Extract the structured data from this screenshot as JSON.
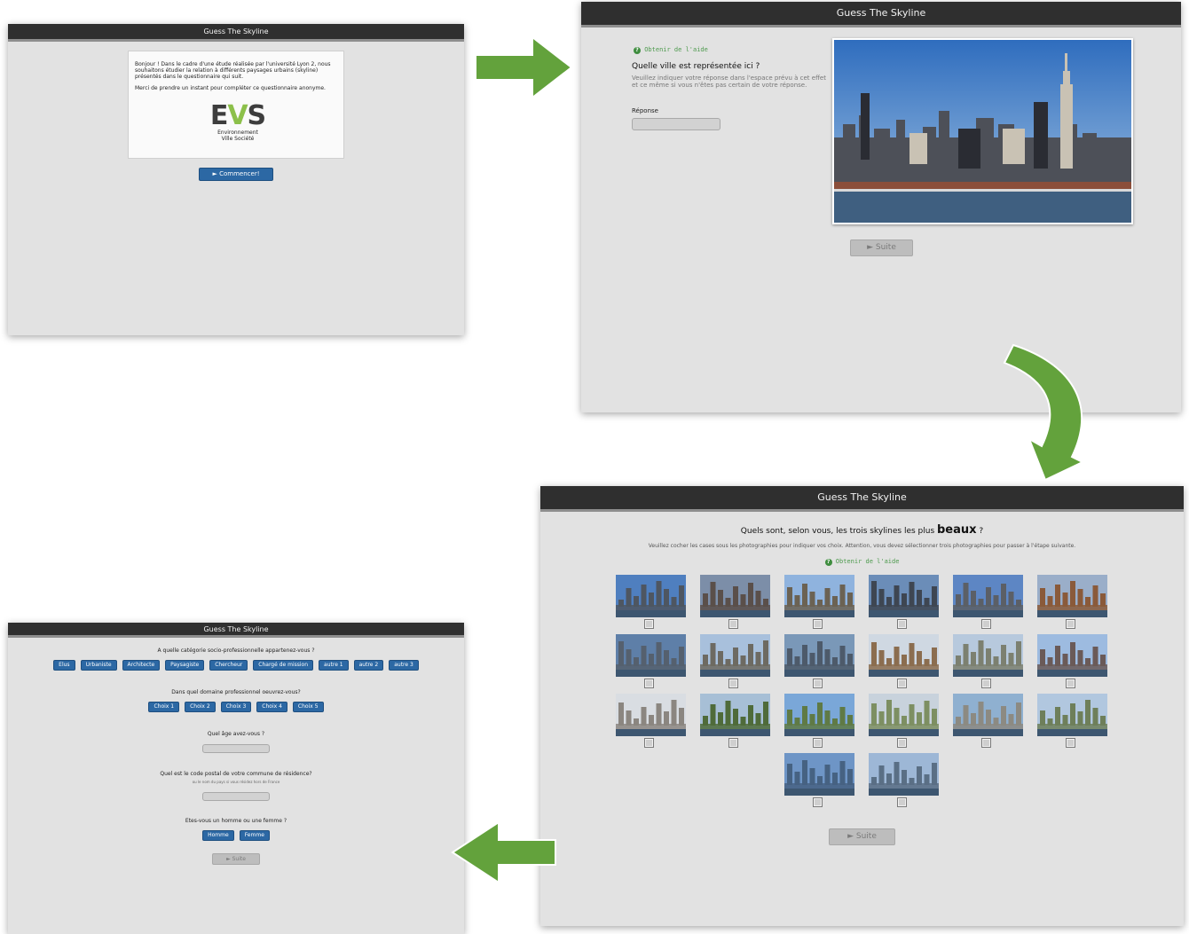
{
  "app_title": "Guess The Skyline",
  "help_label": "Obtenir de l'aide",
  "help_icon": "?",
  "suite_label": "► Suite",
  "intro": {
    "paragraph1": "Bonjour ! Dans le cadre d'une étude réalisée par l'université Lyon 2, nous souhaitons étudier la relation à différents paysages urbains (skyline) présentés dans le questionnaire qui suit.",
    "paragraph2": "Merci de prendre un instant pour compléter ce questionnaire anonyme.",
    "logo_letters": {
      "e": "E",
      "v": "V",
      "s": "S"
    },
    "logo_line1": "Environnement",
    "logo_line2": "Ville Société",
    "start_label": "► Commencer!"
  },
  "guess": {
    "question": "Quelle ville est représentée ici ?",
    "instructions": "Veuillez indiquer votre réponse dans l'espace prévu à cet effet et ce même si vous n'êtes pas certain de votre réponse.",
    "answer_label": "Réponse",
    "answer_value": ""
  },
  "ranking": {
    "question_prefix": "Quels sont, selon vous, les trois skylines les plus ",
    "question_emphasis": "beaux",
    "question_suffix": " ?",
    "instructions": "Veuillez cocher les cases sous les photographies pour indiquer vos choix. Attention, vous devez sélectionner trois photographies pour passer à l'étape suivante.",
    "photo_count": 20
  },
  "profile": {
    "q_category": "A quelle catégorie socio-professionnelle appartenez-vous ?",
    "categories": [
      "Elus",
      "Urbaniste",
      "Architecte",
      "Paysagiste",
      "Chercheur",
      "Chargé de mission",
      "autre 1",
      "autre 2",
      "autre 3"
    ],
    "q_domain": "Dans quel domaine professionnel oeuvrez-vous?",
    "domains": [
      "Choix 1",
      "Choix 2",
      "Choix 3",
      "Choix 4",
      "Choix 5"
    ],
    "q_age": "Quel âge avez-vous ?",
    "age_value": "",
    "q_postal": "Quel est le code postal de votre commune de résidence?",
    "postal_note": "ou le nom du pays si vous résidez hors de France",
    "postal_value": "",
    "q_gender": "Etes-vous un homme ou une femme ?",
    "genders": [
      "Homme",
      "Femme"
    ]
  },
  "colors": {
    "arrow": "#63a23c",
    "title_bar": "#2f2f2f",
    "primary_button": "#2c68a4",
    "help_text": "#4d9a4d"
  }
}
